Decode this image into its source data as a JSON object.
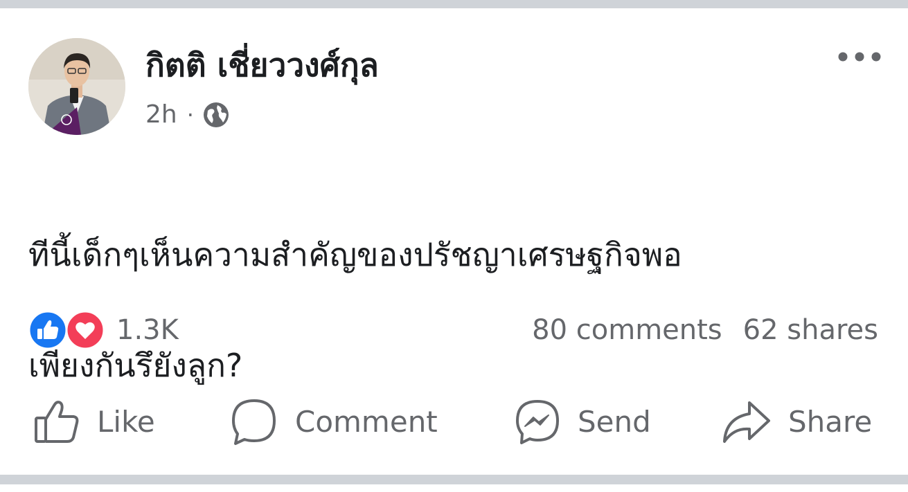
{
  "post": {
    "author": "กิตติ เชี่ยววงศ์กุล",
    "time": "2h",
    "separator": "·",
    "privacy_icon": "globe-icon",
    "more_icon": "more-options-icon",
    "text_line1": "ทีนี้เด็กๆเห็นความสำคัญของปรัชญาเศรษฐกิจพอ",
    "text_line2": "เพียงกันรึยังลูก?"
  },
  "stats": {
    "reaction_icons": [
      "like-reaction-icon",
      "love-reaction-icon"
    ],
    "reaction_count": "1.3K",
    "comments": "80 comments",
    "shares": "62 shares"
  },
  "actions": {
    "like": "Like",
    "comment": "Comment",
    "send": "Send",
    "share": "Share"
  },
  "colors": {
    "text_primary": "#1c1e21",
    "text_secondary": "#65676b",
    "like_blue": "#1877f2",
    "love_red": "#f33e58",
    "divider": "#cfd3d8"
  }
}
